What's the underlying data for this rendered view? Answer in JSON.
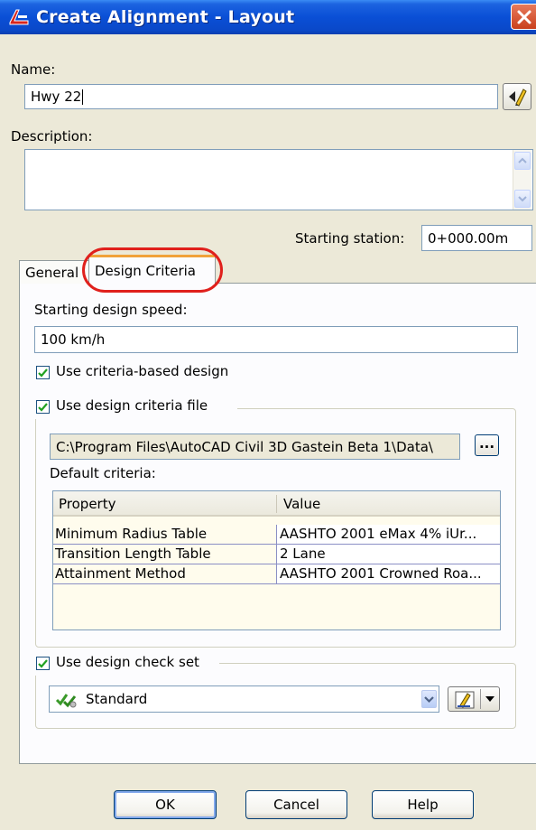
{
  "window": {
    "title": "Create Alignment - Layout"
  },
  "name": {
    "label": "Name:",
    "value": "Hwy 22"
  },
  "description": {
    "label": "Description:",
    "value": ""
  },
  "starting_station": {
    "label": "Starting station:",
    "value": "0+000.00m"
  },
  "tabs": [
    {
      "label": "General",
      "active": false
    },
    {
      "label": "Design Criteria",
      "active": true
    }
  ],
  "design_speed": {
    "label": "Starting design speed:",
    "value": "100 km/h"
  },
  "criteria_based": {
    "label": "Use criteria-based design",
    "checked": true
  },
  "criteria_file": {
    "label": "Use design criteria file",
    "checked": true,
    "path": "C:\\Program Files\\AutoCAD Civil 3D Gastein Beta 1\\Data\\",
    "browse_label": "...",
    "default_criteria_label": "Default criteria:",
    "columns": [
      "Property",
      "Value"
    ],
    "rows": [
      {
        "property": "Minimum Radius Table",
        "value": "AASHTO 2001 eMax 4% iUr..."
      },
      {
        "property": "Transition Length Table",
        "value": "2 Lane"
      },
      {
        "property": "Attainment Method",
        "value": "AASHTO 2001 Crowned Roa..."
      }
    ]
  },
  "check_set": {
    "label": "Use design check set",
    "checked": true,
    "selected": "Standard"
  },
  "buttons": {
    "ok": "OK",
    "cancel": "Cancel",
    "help": "Help"
  },
  "colors": {
    "title_bar": "#0a4fd6",
    "highlight": "#e0201c",
    "tab_accent": "#f1a23a",
    "dialog_bg": "#ece9d8"
  }
}
